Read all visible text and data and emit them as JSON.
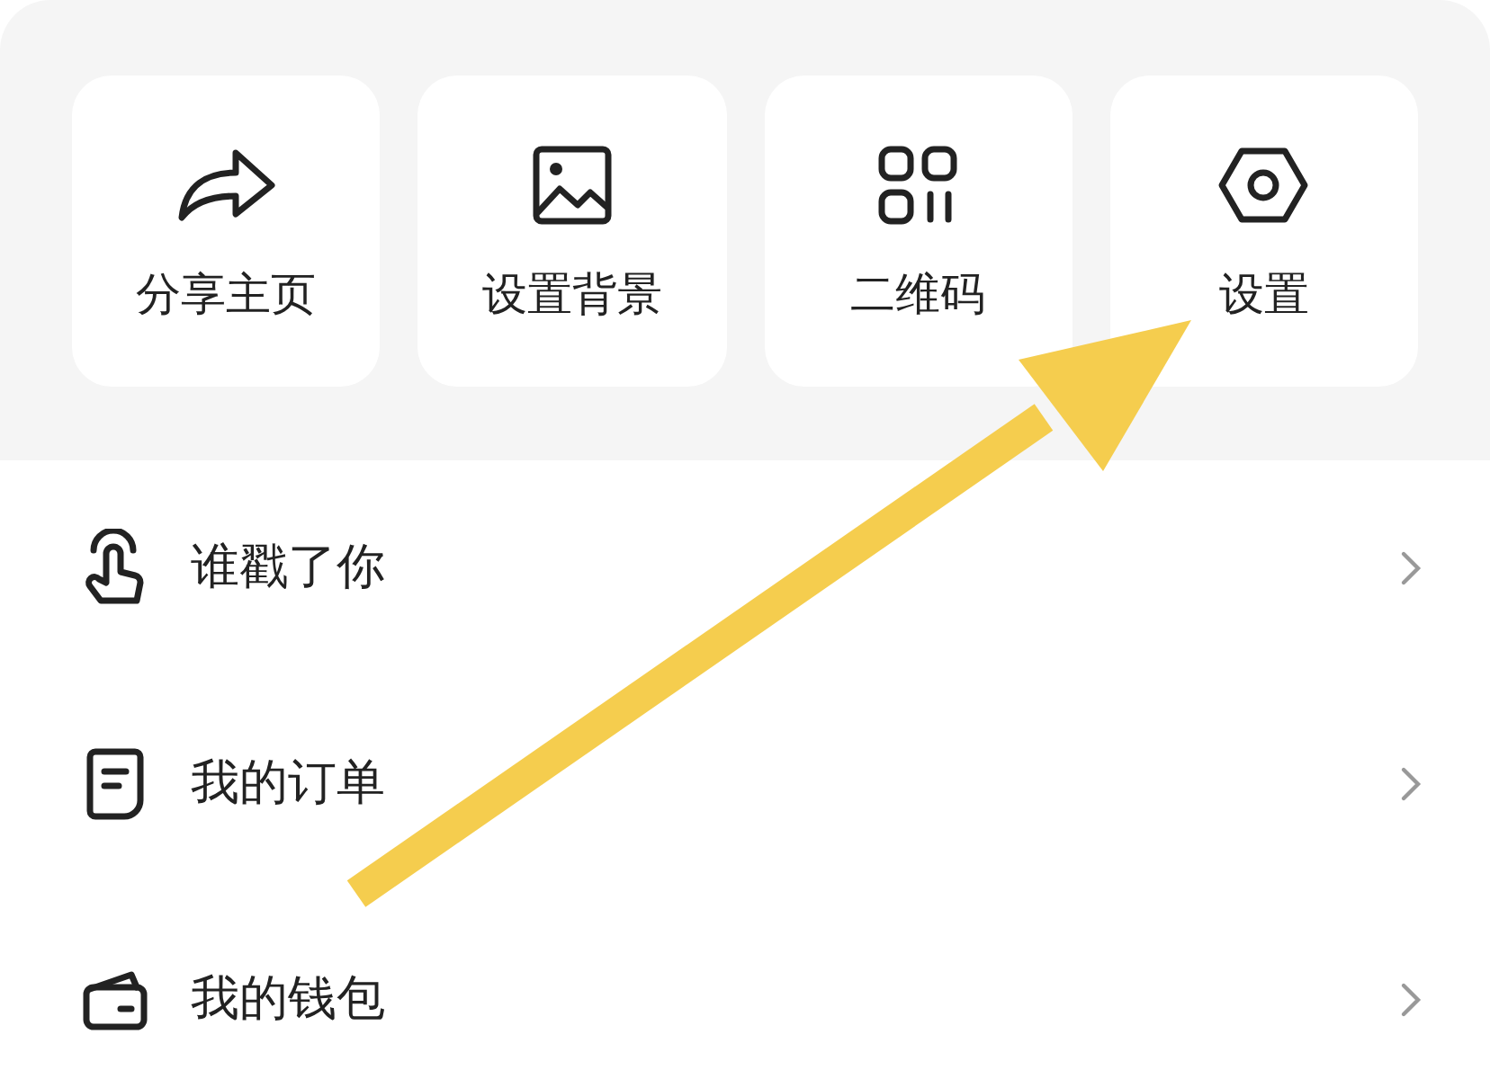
{
  "quick_actions": [
    {
      "kind": "share",
      "label": "分享主页"
    },
    {
      "kind": "image",
      "label": "设置背景"
    },
    {
      "kind": "qrcode",
      "label": "二维码"
    },
    {
      "kind": "settings",
      "label": "设置"
    }
  ],
  "menu": [
    {
      "kind": "tap",
      "label": "谁戳了你"
    },
    {
      "kind": "order",
      "label": "我的订单"
    },
    {
      "kind": "wallet",
      "label": "我的钱包"
    }
  ]
}
